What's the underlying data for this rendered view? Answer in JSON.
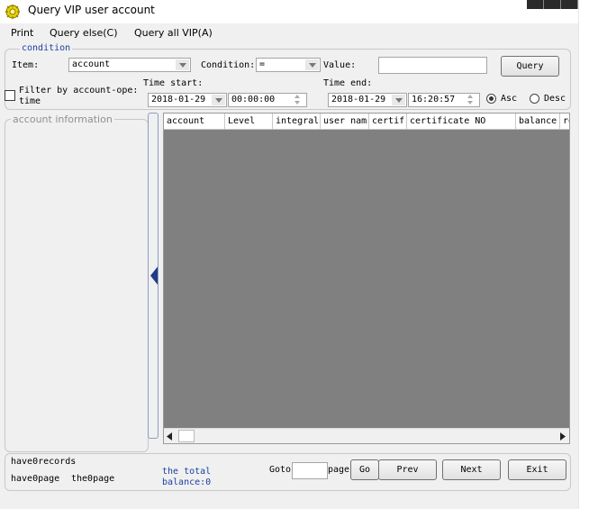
{
  "window": {
    "title": "Query VIP user account",
    "icon": "app-gear-icon"
  },
  "menu": [
    {
      "label": "Print"
    },
    {
      "label": "Query else(C)"
    },
    {
      "label": "Query all VIP(A)"
    }
  ],
  "condition": {
    "legend": "condition",
    "item_label": "Item:",
    "item_value": "account",
    "condition_label": "Condition:",
    "condition_value": "=",
    "value_label": "Value:",
    "value_text": "",
    "query_button": "Query"
  },
  "filter": {
    "label_line1": "Filter by account-ope:",
    "label_line2": "time",
    "checked": false
  },
  "time_start": {
    "label": "Time start:",
    "date": "2018-01-29",
    "time": "00:00:00"
  },
  "time_end": {
    "label": "Time end:",
    "date": "2018-01-29",
    "time": "16:20:57"
  },
  "order": {
    "asc": "Asc",
    "desc": "Desc",
    "selected": "asc"
  },
  "account_info": {
    "legend": "account information"
  },
  "grid": {
    "columns": [
      "account",
      "Level",
      "integral",
      "user nam",
      "certif",
      "certificate NO",
      "balance",
      "re"
    ],
    "rows": []
  },
  "footer": {
    "records": "have0records",
    "pages": "have0page",
    "current_page": "the0page",
    "total_line1": "the total",
    "total_line2": "balance:0",
    "goto_label": "Goto",
    "page_label": "page",
    "goto_value": "",
    "go_button": "Go",
    "prev_button": "Prev",
    "next_button": "Next",
    "exit_button": "Exit"
  }
}
